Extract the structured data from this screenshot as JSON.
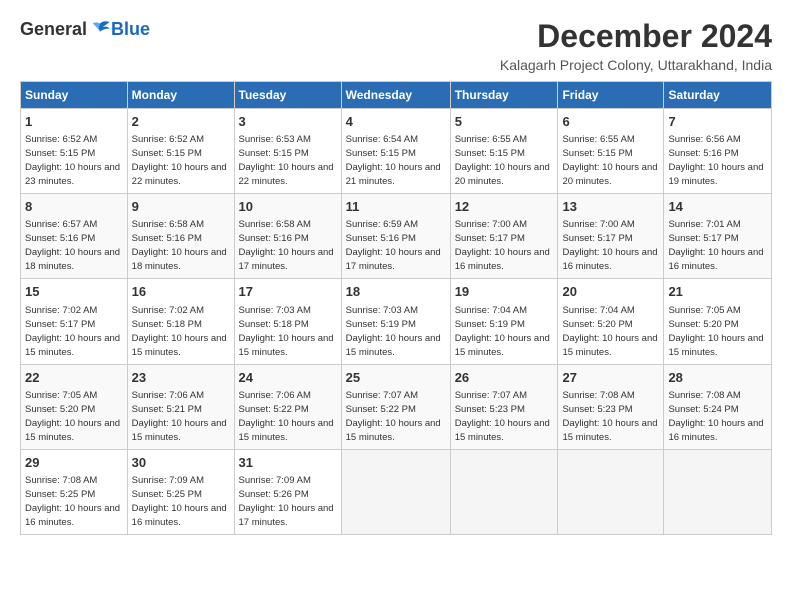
{
  "logo": {
    "general": "General",
    "blue": "Blue"
  },
  "header": {
    "month": "December 2024",
    "location": "Kalagarh Project Colony, Uttarakhand, India"
  },
  "weekdays": [
    "Sunday",
    "Monday",
    "Tuesday",
    "Wednesday",
    "Thursday",
    "Friday",
    "Saturday"
  ],
  "weeks": [
    [
      {
        "day": "1",
        "sunrise": "6:52 AM",
        "sunset": "5:15 PM",
        "daylight": "10 hours and 23 minutes."
      },
      {
        "day": "2",
        "sunrise": "6:52 AM",
        "sunset": "5:15 PM",
        "daylight": "10 hours and 22 minutes."
      },
      {
        "day": "3",
        "sunrise": "6:53 AM",
        "sunset": "5:15 PM",
        "daylight": "10 hours and 22 minutes."
      },
      {
        "day": "4",
        "sunrise": "6:54 AM",
        "sunset": "5:15 PM",
        "daylight": "10 hours and 21 minutes."
      },
      {
        "day": "5",
        "sunrise": "6:55 AM",
        "sunset": "5:15 PM",
        "daylight": "10 hours and 20 minutes."
      },
      {
        "day": "6",
        "sunrise": "6:55 AM",
        "sunset": "5:15 PM",
        "daylight": "10 hours and 20 minutes."
      },
      {
        "day": "7",
        "sunrise": "6:56 AM",
        "sunset": "5:16 PM",
        "daylight": "10 hours and 19 minutes."
      }
    ],
    [
      {
        "day": "8",
        "sunrise": "6:57 AM",
        "sunset": "5:16 PM",
        "daylight": "10 hours and 18 minutes."
      },
      {
        "day": "9",
        "sunrise": "6:58 AM",
        "sunset": "5:16 PM",
        "daylight": "10 hours and 18 minutes."
      },
      {
        "day": "10",
        "sunrise": "6:58 AM",
        "sunset": "5:16 PM",
        "daylight": "10 hours and 17 minutes."
      },
      {
        "day": "11",
        "sunrise": "6:59 AM",
        "sunset": "5:16 PM",
        "daylight": "10 hours and 17 minutes."
      },
      {
        "day": "12",
        "sunrise": "7:00 AM",
        "sunset": "5:17 PM",
        "daylight": "10 hours and 16 minutes."
      },
      {
        "day": "13",
        "sunrise": "7:00 AM",
        "sunset": "5:17 PM",
        "daylight": "10 hours and 16 minutes."
      },
      {
        "day": "14",
        "sunrise": "7:01 AM",
        "sunset": "5:17 PM",
        "daylight": "10 hours and 16 minutes."
      }
    ],
    [
      {
        "day": "15",
        "sunrise": "7:02 AM",
        "sunset": "5:17 PM",
        "daylight": "10 hours and 15 minutes."
      },
      {
        "day": "16",
        "sunrise": "7:02 AM",
        "sunset": "5:18 PM",
        "daylight": "10 hours and 15 minutes."
      },
      {
        "day": "17",
        "sunrise": "7:03 AM",
        "sunset": "5:18 PM",
        "daylight": "10 hours and 15 minutes."
      },
      {
        "day": "18",
        "sunrise": "7:03 AM",
        "sunset": "5:19 PM",
        "daylight": "10 hours and 15 minutes."
      },
      {
        "day": "19",
        "sunrise": "7:04 AM",
        "sunset": "5:19 PM",
        "daylight": "10 hours and 15 minutes."
      },
      {
        "day": "20",
        "sunrise": "7:04 AM",
        "sunset": "5:20 PM",
        "daylight": "10 hours and 15 minutes."
      },
      {
        "day": "21",
        "sunrise": "7:05 AM",
        "sunset": "5:20 PM",
        "daylight": "10 hours and 15 minutes."
      }
    ],
    [
      {
        "day": "22",
        "sunrise": "7:05 AM",
        "sunset": "5:20 PM",
        "daylight": "10 hours and 15 minutes."
      },
      {
        "day": "23",
        "sunrise": "7:06 AM",
        "sunset": "5:21 PM",
        "daylight": "10 hours and 15 minutes."
      },
      {
        "day": "24",
        "sunrise": "7:06 AM",
        "sunset": "5:22 PM",
        "daylight": "10 hours and 15 minutes."
      },
      {
        "day": "25",
        "sunrise": "7:07 AM",
        "sunset": "5:22 PM",
        "daylight": "10 hours and 15 minutes."
      },
      {
        "day": "26",
        "sunrise": "7:07 AM",
        "sunset": "5:23 PM",
        "daylight": "10 hours and 15 minutes."
      },
      {
        "day": "27",
        "sunrise": "7:08 AM",
        "sunset": "5:23 PM",
        "daylight": "10 hours and 15 minutes."
      },
      {
        "day": "28",
        "sunrise": "7:08 AM",
        "sunset": "5:24 PM",
        "daylight": "10 hours and 16 minutes."
      }
    ],
    [
      {
        "day": "29",
        "sunrise": "7:08 AM",
        "sunset": "5:25 PM",
        "daylight": "10 hours and 16 minutes."
      },
      {
        "day": "30",
        "sunrise": "7:09 AM",
        "sunset": "5:25 PM",
        "daylight": "10 hours and 16 minutes."
      },
      {
        "day": "31",
        "sunrise": "7:09 AM",
        "sunset": "5:26 PM",
        "daylight": "10 hours and 17 minutes."
      },
      null,
      null,
      null,
      null
    ]
  ]
}
